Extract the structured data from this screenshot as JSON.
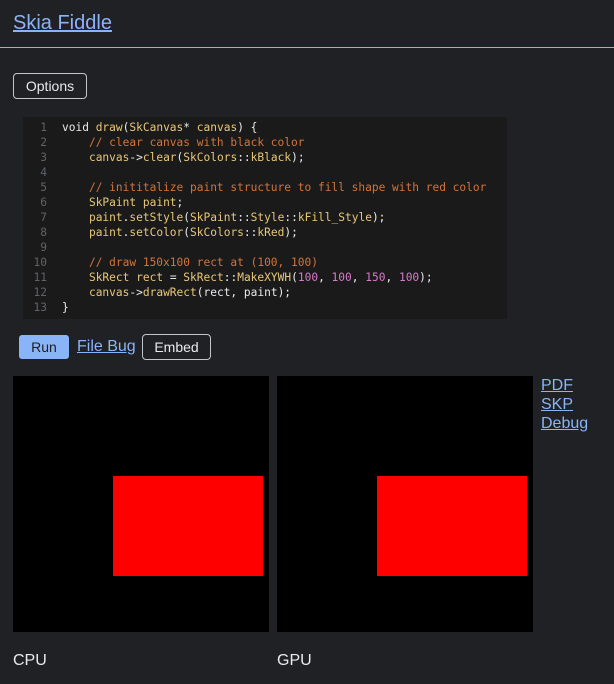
{
  "header": {
    "title": "Skia Fiddle"
  },
  "toolbar": {
    "options_label": "Options"
  },
  "editor": {
    "lines": [
      {
        "n": "1",
        "segments": [
          [
            "kw",
            "void "
          ],
          [
            "fn",
            "draw"
          ],
          [
            "kw",
            "("
          ],
          [
            "type",
            "SkCanvas"
          ],
          [
            "kw",
            "* "
          ],
          [
            "type",
            "canvas"
          ],
          [
            "kw",
            ") {"
          ]
        ]
      },
      {
        "n": "2",
        "segments": [
          [
            "kw",
            "    "
          ],
          [
            "comment",
            "// clear canvas with black color"
          ]
        ]
      },
      {
        "n": "3",
        "segments": [
          [
            "kw",
            "    "
          ],
          [
            "type",
            "canvas"
          ],
          [
            "kw",
            "->"
          ],
          [
            "fn",
            "clear"
          ],
          [
            "kw",
            "("
          ],
          [
            "type",
            "SkColors"
          ],
          [
            "kw",
            "::"
          ],
          [
            "type",
            "kBlack"
          ],
          [
            "kw",
            ");"
          ]
        ]
      },
      {
        "n": "4",
        "segments": []
      },
      {
        "n": "5",
        "segments": [
          [
            "kw",
            "    "
          ],
          [
            "comment",
            "// inititalize paint structure to fill shape with red color"
          ]
        ]
      },
      {
        "n": "6",
        "segments": [
          [
            "kw",
            "    "
          ],
          [
            "type",
            "SkPaint"
          ],
          [
            "kw",
            " "
          ],
          [
            "type",
            "paint"
          ],
          [
            "kw",
            ";"
          ]
        ]
      },
      {
        "n": "7",
        "segments": [
          [
            "kw",
            "    "
          ],
          [
            "type",
            "paint"
          ],
          [
            "kw",
            "."
          ],
          [
            "fn",
            "setStyle"
          ],
          [
            "kw",
            "("
          ],
          [
            "type",
            "SkPaint"
          ],
          [
            "kw",
            "::"
          ],
          [
            "type",
            "Style"
          ],
          [
            "kw",
            "::"
          ],
          [
            "type",
            "kFill_Style"
          ],
          [
            "kw",
            ");"
          ]
        ]
      },
      {
        "n": "8",
        "segments": [
          [
            "kw",
            "    "
          ],
          [
            "type",
            "paint"
          ],
          [
            "kw",
            "."
          ],
          [
            "fn",
            "setColor"
          ],
          [
            "kw",
            "("
          ],
          [
            "type",
            "SkColors"
          ],
          [
            "kw",
            "::"
          ],
          [
            "type",
            "kRed"
          ],
          [
            "kw",
            ");"
          ]
        ]
      },
      {
        "n": "9",
        "segments": []
      },
      {
        "n": "10",
        "segments": [
          [
            "kw",
            "    "
          ],
          [
            "comment",
            "// draw 150x100 rect at (100, 100)"
          ]
        ]
      },
      {
        "n": "11",
        "segments": [
          [
            "kw",
            "    "
          ],
          [
            "type",
            "SkRect"
          ],
          [
            "kw",
            " "
          ],
          [
            "type",
            "rect"
          ],
          [
            "kw",
            " = "
          ],
          [
            "type",
            "SkRect"
          ],
          [
            "kw",
            "::"
          ],
          [
            "fn",
            "MakeXYWH"
          ],
          [
            "kw",
            "("
          ],
          [
            "num",
            "100"
          ],
          [
            "kw",
            ", "
          ],
          [
            "num",
            "100"
          ],
          [
            "kw",
            ", "
          ],
          [
            "num",
            "150"
          ],
          [
            "kw",
            ", "
          ],
          [
            "num",
            "100"
          ],
          [
            "kw",
            ");"
          ]
        ]
      },
      {
        "n": "12",
        "segments": [
          [
            "kw",
            "    "
          ],
          [
            "type",
            "canvas"
          ],
          [
            "kw",
            "->"
          ],
          [
            "fn",
            "drawRect"
          ],
          [
            "kw",
            "(rect, paint);"
          ]
        ]
      },
      {
        "n": "13",
        "segments": [
          [
            "kw",
            "}"
          ]
        ]
      }
    ]
  },
  "actions": {
    "run_label": "Run",
    "file_bug_label": "File Bug",
    "embed_label": "Embed"
  },
  "outputs": {
    "cpu_label": "CPU",
    "gpu_label": "GPU",
    "links": [
      "PDF",
      "SKP",
      "Debug"
    ]
  },
  "colors": {
    "background": "#202124",
    "accent": "#8ab4f8",
    "rect_fill": "#ff0000",
    "canvas_fill": "#000000"
  }
}
